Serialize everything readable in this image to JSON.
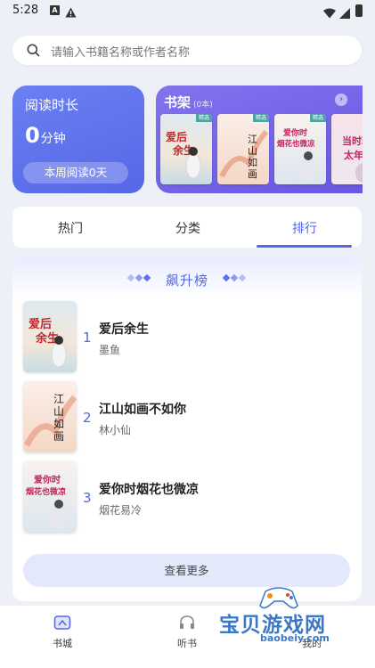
{
  "status_bar": {
    "time": "5:28",
    "notification_letter": "A"
  },
  "search": {
    "placeholder": "请输入书籍名称或作者名称"
  },
  "reading": {
    "title": "阅读时长",
    "value": "0",
    "unit": "分钟",
    "week_label": "本周阅读0天"
  },
  "shelf": {
    "title": "书架",
    "count": "(0本)",
    "books": [
      {
        "title": "爱后余生",
        "badge": "精选"
      },
      {
        "title": "江山如画不如你",
        "badge": "精选"
      },
      {
        "title": "爱你时烟花也微凉",
        "badge": "精选"
      },
      {
        "title": "当时若 太年",
        "badge": ""
      }
    ]
  },
  "tabs": [
    {
      "label": "热门",
      "active": false
    },
    {
      "label": "分类",
      "active": false
    },
    {
      "label": "排行",
      "active": true
    }
  ],
  "ranking": {
    "title": "飙升榜",
    "items": [
      {
        "rank": "1",
        "name": "爱后余生",
        "author": "墨鱼",
        "cover_text": "爱后余生"
      },
      {
        "rank": "2",
        "name": "江山如画不如你",
        "author": "林小仙",
        "cover_text": "江山如画"
      },
      {
        "rank": "3",
        "name": "爱你时烟花也微凉",
        "author": "烟花易冷",
        "cover_text": "爱你时 烟花也微凉"
      }
    ],
    "more_label": "查看更多"
  },
  "nav": [
    {
      "label": "书城",
      "icon": "bookstore-icon",
      "active": true
    },
    {
      "label": "听书",
      "icon": "headphones-icon",
      "active": false
    },
    {
      "label": "我的",
      "icon": "profile-icon",
      "active": false
    }
  ],
  "watermark": {
    "text": "宝贝游戏网",
    "url": "baobeiy.com"
  },
  "colors": {
    "accent": "#5667e6",
    "shelf": "#7463ea",
    "background": "#eef0f8"
  }
}
